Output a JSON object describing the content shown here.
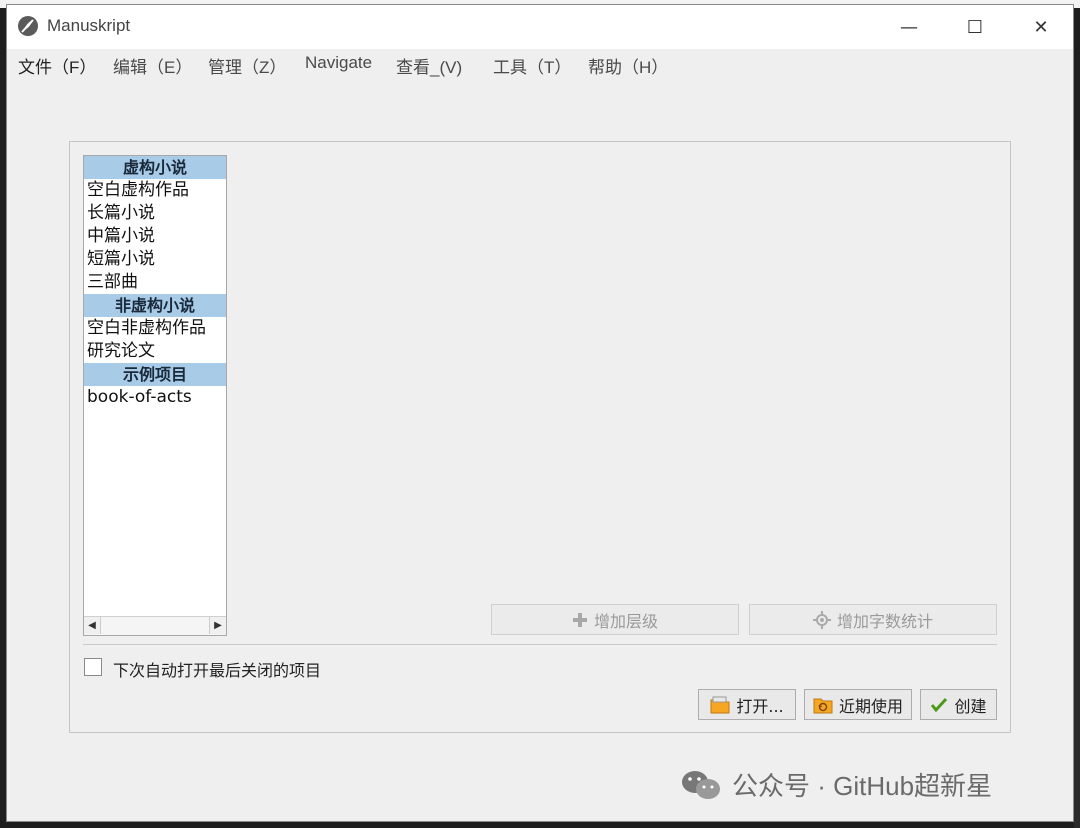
{
  "window": {
    "title": "Manuskript",
    "controls": {
      "minimize": "—",
      "maximize": "☐",
      "close": "✕"
    }
  },
  "menu": [
    {
      "label": "文件（F）"
    },
    {
      "label": "编辑（E）"
    },
    {
      "label": "管理（Z）"
    },
    {
      "label": "Navigate"
    },
    {
      "label": "查看_(V)"
    },
    {
      "label": "工具（T）"
    },
    {
      "label": "帮助（H）"
    }
  ],
  "templates": {
    "groups": [
      {
        "header": "虚构小说",
        "items": [
          "空白虚构作品",
          "长篇小说",
          "中篇小说",
          "短篇小说",
          "三部曲"
        ]
      },
      {
        "header": "非虚构小说",
        "items": [
          "空白非虚构作品",
          "研究论文"
        ]
      },
      {
        "header": "示例项目",
        "items": [
          "book-of-acts"
        ]
      }
    ]
  },
  "buttons": {
    "add_level": "增加层级",
    "add_wordcount": "增加字数统计",
    "open": "打开...",
    "recent": "近期使用",
    "create": "创建"
  },
  "checkbox": {
    "label": "下次自动打开最后关闭的项目",
    "checked": false
  },
  "watermark": {
    "text": "公众号 · GitHub超新星"
  }
}
